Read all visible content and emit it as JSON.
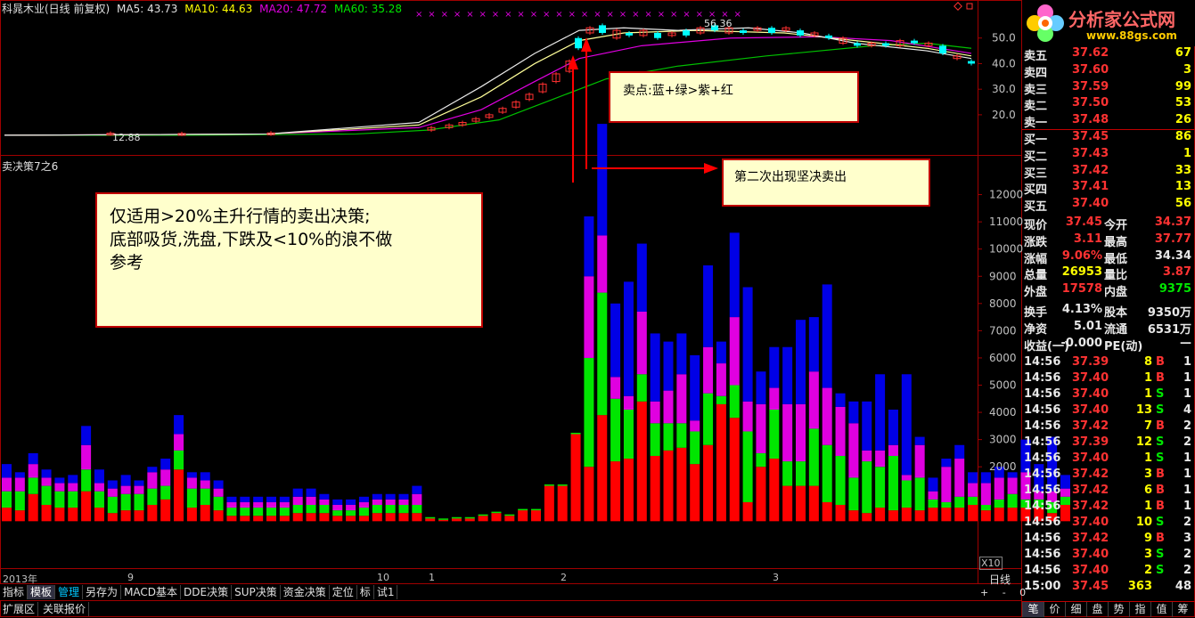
{
  "header": {
    "stock": "科晁木业(日线 前复权)",
    "ma5": "MA5: 43.73",
    "ma10": "MA10: 44.63",
    "ma20": "MA20: 47.72",
    "ma60": "MA60: 35.28"
  },
  "indicator_title": "卖决策7之6",
  "annotations": {
    "sell_point": "卖点:蓝+绿>紫+红",
    "second_sell": "第二次出现坚决卖出",
    "note_line1": "仅适用>20%主升行情的卖出决策;",
    "note_line2": "底部吸货,洗盘,下跌及<10%的浪不做",
    "note_line3": "参考"
  },
  "price_labels": {
    "high": "56.36",
    "low": "12.88"
  },
  "x_axis": {
    "year": "2013年",
    "m9": "9",
    "m10": "10",
    "m1": "1",
    "m2": "2",
    "m3": "3",
    "zoom": "X10",
    "period": "日线"
  },
  "tabs": [
    "指标",
    "模板",
    "管理",
    "另存为",
    "MACD基本",
    "DDE决策",
    "SUP决策",
    "资金决策",
    "定位",
    "标",
    "试1"
  ],
  "tabs2": [
    "扩展区",
    "关联报价"
  ],
  "logo": {
    "name": "分析家公式网",
    "url": "www.88gs.com"
  },
  "order_book": [
    {
      "label": "卖五",
      "price": "37.62",
      "vol": "67"
    },
    {
      "label": "卖四",
      "price": "37.60",
      "vol": "3"
    },
    {
      "label": "卖三",
      "price": "37.59",
      "vol": "99"
    },
    {
      "label": "卖二",
      "price": "37.50",
      "vol": "53"
    },
    {
      "label": "卖一",
      "price": "37.48",
      "vol": "26"
    },
    {
      "label": "买一",
      "price": "37.45",
      "vol": "86"
    },
    {
      "label": "买二",
      "price": "37.43",
      "vol": "1"
    },
    {
      "label": "买三",
      "price": "37.42",
      "vol": "33"
    },
    {
      "label": "买四",
      "price": "37.41",
      "vol": "13"
    },
    {
      "label": "买五",
      "price": "37.40",
      "vol": "56"
    }
  ],
  "quote": [
    {
      "l1": "现价",
      "v1": "37.45",
      "l2": "今开",
      "v2": "34.37"
    },
    {
      "l1": "涨跌",
      "v1": "3.11",
      "l2": "最高",
      "v2": "37.77"
    },
    {
      "l1": "涨幅",
      "v1": "9.06%",
      "l2": "最低",
      "v2": "34.34"
    },
    {
      "l1": "总量",
      "v1": "26953",
      "l2": "量比",
      "v2": "3.87"
    },
    {
      "l1": "外盘",
      "v1": "17578",
      "l2": "内盘",
      "v2": "9375"
    }
  ],
  "fund": [
    {
      "l1": "换手",
      "v1": "4.13%",
      "l2": "股本",
      "v2": "9350万"
    },
    {
      "l1": "净资",
      "v1": "5.01",
      "l2": "流通",
      "v2": "6531万"
    },
    {
      "l1": "收益(一)",
      "v1": "-0.000",
      "l2": "PE(动)",
      "v2": "—"
    }
  ],
  "ticks": [
    {
      "t": "14:56",
      "p": "37.39",
      "v": "8",
      "s": "B",
      "n": "1"
    },
    {
      "t": "14:56",
      "p": "37.40",
      "v": "1",
      "s": "B",
      "n": "1"
    },
    {
      "t": "14:56",
      "p": "37.40",
      "v": "1",
      "s": "S",
      "n": "1"
    },
    {
      "t": "14:56",
      "p": "37.40",
      "v": "13",
      "s": "S",
      "n": "4"
    },
    {
      "t": "14:56",
      "p": "37.42",
      "v": "7",
      "s": "B",
      "n": "2"
    },
    {
      "t": "14:56",
      "p": "37.39",
      "v": "12",
      "s": "S",
      "n": "2"
    },
    {
      "t": "14:56",
      "p": "37.40",
      "v": "1",
      "s": "S",
      "n": "1"
    },
    {
      "t": "14:56",
      "p": "37.42",
      "v": "3",
      "s": "B",
      "n": "1"
    },
    {
      "t": "14:56",
      "p": "37.42",
      "v": "6",
      "s": "B",
      "n": "1"
    },
    {
      "t": "14:56",
      "p": "37.42",
      "v": "1",
      "s": "B",
      "n": "1"
    },
    {
      "t": "14:56",
      "p": "37.40",
      "v": "10",
      "s": "S",
      "n": "2"
    },
    {
      "t": "14:56",
      "p": "37.42",
      "v": "9",
      "s": "B",
      "n": "3"
    },
    {
      "t": "14:56",
      "p": "37.40",
      "v": "3",
      "s": "S",
      "n": "2"
    },
    {
      "t": "14:56",
      "p": "37.40",
      "v": "2",
      "s": "S",
      "n": "2"
    },
    {
      "t": "15:00",
      "p": "37.45",
      "v": "363",
      "s": "",
      "n": "48"
    }
  ],
  "bottom_tabs": [
    "笔",
    "价",
    "细",
    "盘",
    "势",
    "指",
    "值",
    "筹"
  ],
  "chart_data": {
    "type": "bar",
    "price_axis": {
      "ticks": [
        50,
        40,
        30,
        20
      ],
      "ylim": [
        5,
        60
      ]
    },
    "volume_axis": {
      "ticks": [
        12000,
        11000,
        10000,
        9000,
        8000,
        7000,
        6000,
        5000,
        4000,
        3000,
        2000
      ],
      "ylim": [
        -1200,
        13000
      ]
    },
    "series": [
      {
        "name": "红",
        "color": "#ff0000",
        "values": [
          500,
          400,
          1000,
          600,
          500,
          500,
          1100,
          500,
          300,
          400,
          400,
          600,
          800,
          1900,
          500,
          600,
          400,
          200,
          200,
          200,
          200,
          200,
          300,
          300,
          300,
          200,
          200,
          200,
          300,
          300,
          300,
          300,
          100,
          50,
          100,
          100,
          200,
          300,
          200,
          400,
          400,
          1300,
          1300,
          3200,
          2000,
          3900,
          2200,
          2300,
          4400,
          2400,
          2600,
          2700,
          2100,
          2800,
          4300,
          3800,
          700,
          2000,
          2300,
          1300,
          1300,
          1300,
          700,
          600,
          400,
          300,
          500,
          400,
          500,
          400,
          500,
          500,
          500,
          600,
          400,
          500,
          500,
          500,
          500,
          300,
          600
        ]
      },
      {
        "name": "绿",
        "color": "#00e600",
        "values": [
          600,
          700,
          600,
          700,
          600,
          600,
          800,
          600,
          600,
          600,
          600,
          600,
          500,
          700,
          700,
          600,
          500,
          300,
          300,
          300,
          300,
          300,
          300,
          300,
          300,
          200,
          200,
          300,
          300,
          300,
          300,
          300,
          50,
          50,
          50,
          50,
          50,
          50,
          50,
          50,
          50,
          50,
          50,
          50,
          4000,
          4500,
          2300,
          1800,
          1000,
          1200,
          1000,
          900,
          1200,
          1900,
          300,
          1200,
          2600,
          500,
          1800,
          900,
          900,
          2100,
          2100,
          1800,
          1200,
          1900,
          1500,
          2000,
          1000,
          1200,
          300,
          200,
          400,
          300,
          200,
          300,
          500,
          300,
          300,
          400,
          300
        ]
      },
      {
        "name": "紫",
        "color": "#e000e0",
        "values": [
          500,
          500,
          500,
          300,
          300,
          300,
          900,
          300,
          300,
          300,
          300,
          600,
          600,
          600,
          400,
          300,
          300,
          200,
          200,
          200,
          200,
          200,
          300,
          300,
          200,
          200,
          200,
          200,
          200,
          200,
          200,
          400,
          0,
          0,
          0,
          0,
          0,
          0,
          0,
          0,
          0,
          0,
          0,
          0,
          3000,
          2100,
          800,
          500,
          2300,
          800,
          1200,
          1800,
          400,
          1700,
          1200,
          2500,
          1100,
          1800,
          800,
          2100,
          2100,
          2100,
          2100,
          1800,
          2000,
          400,
          600,
          400,
          200,
          1200,
          300,
          1300,
          1400,
          500,
          800,
          800,
          600,
          1000,
          300,
          400,
          300
        ]
      },
      {
        "name": "蓝",
        "color": "#0000e6",
        "values": [
          500,
          200,
          400,
          300,
          200,
          300,
          700,
          500,
          300,
          400,
          200,
          200,
          400,
          700,
          200,
          300,
          300,
          200,
          200,
          200,
          200,
          200,
          300,
          300,
          200,
          200,
          200,
          200,
          200,
          200,
          200,
          300,
          0,
          0,
          0,
          0,
          0,
          0,
          0,
          0,
          0,
          0,
          0,
          0,
          2200,
          4100,
          2700,
          4200,
          2500,
          2500,
          1800,
          1500,
          2400,
          3000,
          800,
          3100,
          4200,
          1200,
          1500,
          2100,
          3100,
          2000,
          3800,
          500,
          800,
          1800,
          2800,
          1300,
          3700,
          300,
          500,
          300,
          500,
          400,
          400,
          400,
          200,
          1200,
          1000,
          2000,
          500
        ]
      }
    ]
  }
}
